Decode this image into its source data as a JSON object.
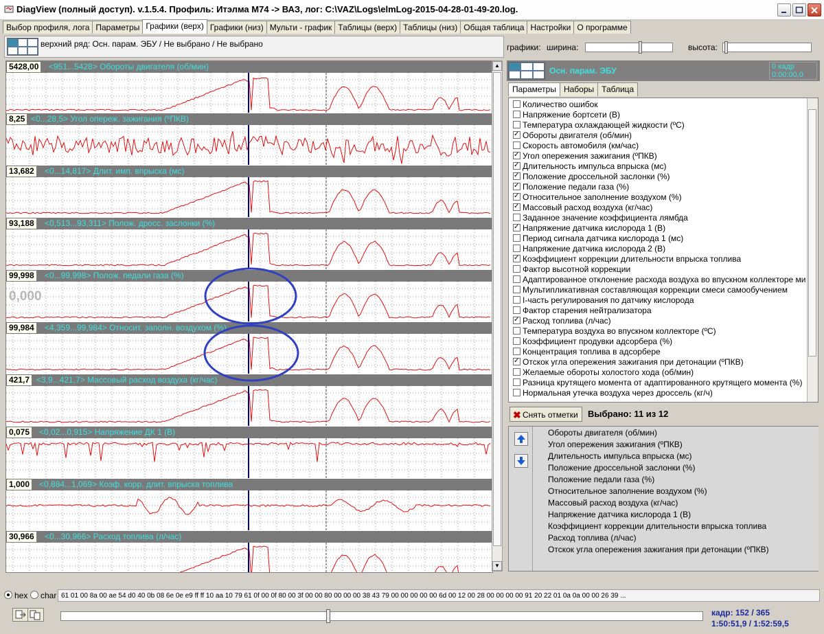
{
  "window": {
    "title": "DiagView (полный доступ). v.1.5.4. Профиль: Итэлма М74 -> ВАЗ,   лог: C:\\VAZ\\Logs\\elmLog-2015-04-28-01-49-20.log."
  },
  "tabs": [
    "Выбор профиля, лога",
    "Параметры",
    "Графики (верх)",
    "Графики (низ)",
    "Мульти - график",
    "Таблицы (верх)",
    "Таблицы (низ)",
    "Общая таблица",
    "Настройки",
    "О программе"
  ],
  "active_tab": "Графики (верх)",
  "toprow_text": "верхний ряд: Осн. парам. ЭБУ / Не выбрано / Не выбрано",
  "sizes": {
    "graphs_label": "графики:",
    "width_label": "ширина:",
    "height_label": "высота:",
    "width_fraction": 0.64,
    "height_fraction": 0.02
  },
  "charts": [
    {
      "value": "5428,00",
      "name": "<951...5428> Обороты двигателя (об/мин)"
    },
    {
      "value": "8,25",
      "name": "<0...28,5> Угол опереж. зажигания (ºПКВ)"
    },
    {
      "value": "13,682",
      "name": "<0...14,817> Длит. имп. впрыска (мс)"
    },
    {
      "value": "93,188",
      "name": "<0,513...93,311> Полож. дросс. заслонки (%)"
    },
    {
      "value": "99,998",
      "name": "<0...99,998> Полож. педали газа (%)"
    },
    {
      "value": "99,984",
      "name": "<4,359...99,984> Относит. заполн. воздухом (%)"
    },
    {
      "value": "421,7",
      "name": "<3,9...421,7> Массовый расход воздуха (кг/час)"
    },
    {
      "value": "0,075",
      "name": "<0,02...0,915> Напряжение ДК 1 (В)"
    },
    {
      "value": "1,000",
      "name": "<0,884...1,069> Коэф. корр. длит. впрыска топлива"
    },
    {
      "value": "30,966",
      "name": "<0...30,966> Расход топлива (л/час)"
    }
  ],
  "chart5_overlay_value": "0,000",
  "panel": {
    "title": "Осн. парам. ЭБУ",
    "counter_line1": "0 кадр",
    "counter_line2": "0:00:00,0",
    "tabs": [
      "Параметры",
      "Наборы",
      "Таблица"
    ],
    "active_tab": "Параметры"
  },
  "params": [
    {
      "label": "Количество ошибок",
      "checked": false
    },
    {
      "label": "Напряжение бортсети (В)",
      "checked": false
    },
    {
      "label": "Температура охлаждающей жидкости (ºС)",
      "checked": false
    },
    {
      "label": "Обороты двигателя (об/мин)",
      "checked": true
    },
    {
      "label": "Скорость автомобиля (км/час)",
      "checked": false
    },
    {
      "label": "Угол опережения зажигания (ºПКВ)",
      "checked": true
    },
    {
      "label": "Длительность импульса впрыска (мс)",
      "checked": true
    },
    {
      "label": "Положение дроссельной заслонки (%)",
      "checked": true
    },
    {
      "label": "Положение педали газа (%)",
      "checked": true
    },
    {
      "label": "Относительное заполнение воздухом (%)",
      "checked": true
    },
    {
      "label": "Массовый расход воздуха (кг/час)",
      "checked": true
    },
    {
      "label": "Заданное значение коэффициента лямбда",
      "checked": false
    },
    {
      "label": "Напряжение датчика кислорода 1 (В)",
      "checked": true
    },
    {
      "label": "Период сигнала датчика кислорода 1 (мс)",
      "checked": false
    },
    {
      "label": "Напряжение датчика кислорода 2 (В)",
      "checked": false
    },
    {
      "label": "Коэффициент коррекции длительности впрыска топлива",
      "checked": true
    },
    {
      "label": "Фактор высотной коррекции",
      "checked": false
    },
    {
      "label": "Адаптированное отклонение расхода воздуха во впускном коллекторе ми",
      "checked": false
    },
    {
      "label": "Мультипликативная составляющая коррекции смеси самообучением",
      "checked": false
    },
    {
      "label": "I-часть регулирования по датчику кислорода",
      "checked": false
    },
    {
      "label": "Фактор старения нейтрализатора",
      "checked": false
    },
    {
      "label": "Расход топлива (л/час)",
      "checked": true
    },
    {
      "label": "Температура воздуха во впускном коллекторе (ºС)",
      "checked": false
    },
    {
      "label": "Коэффициент продувки адсорбера (%)",
      "checked": false
    },
    {
      "label": "Концентрация топлива в адсорбере",
      "checked": false
    },
    {
      "label": "Отскок угла опережения зажигания при детонации (ºПКВ)",
      "checked": true
    },
    {
      "label": "Желаемые обороты холостого хода (об/мин)",
      "checked": false
    },
    {
      "label": "Разница крутящего момента от адаптированного крутящего момента (%)",
      "checked": false
    },
    {
      "label": "Нормальная утечка воздуха через дроссель (кг/ч)",
      "checked": false
    }
  ],
  "clear_label": "Снять отметки",
  "selected_text": "Выбрано: 11 из 12",
  "order_items": [
    "Обороты двигателя (об/мин)",
    "Угол опережения зажигания (ºПКВ)",
    "Длительность импульса впрыска (мс)",
    "Положение дроссельной заслонки (%)",
    "Положение педали газа (%)",
    "Относительное заполнение воздухом (%)",
    "Массовый расход воздуха (кг/час)",
    "Напряжение датчика кислорода 1 (В)",
    "Коэффициент коррекции длительности впрыска топлива",
    "Расход топлива (л/час)",
    "Отскок угла опережения зажигания при детонации (ºПКВ)"
  ],
  "bottom": {
    "hex_label": "hex",
    "char_label": "char",
    "hex_data": "61 01 00 8a 00 ae 54 d0 40 0b 08 6e 0e e9 ff ff 10 aa 10 79 61 0f 00 0f 80 00 3f 00 00 80 00 00 00 38 43 79 00 00 00 00 00 6d 00 12 00 28 00 00 00 00 91 20 22 01 0a 0a 00 00 26 39 ...",
    "frame_line1": "кадр: 152 / 365",
    "frame_line2": "1:50:51,9 / 1:52:59,5",
    "position_fraction": 0.416
  },
  "colors": {
    "trace": "#e01010",
    "cursor": "#000080",
    "highlight": "#3040c0",
    "header_text": "#3ee0e0"
  }
}
